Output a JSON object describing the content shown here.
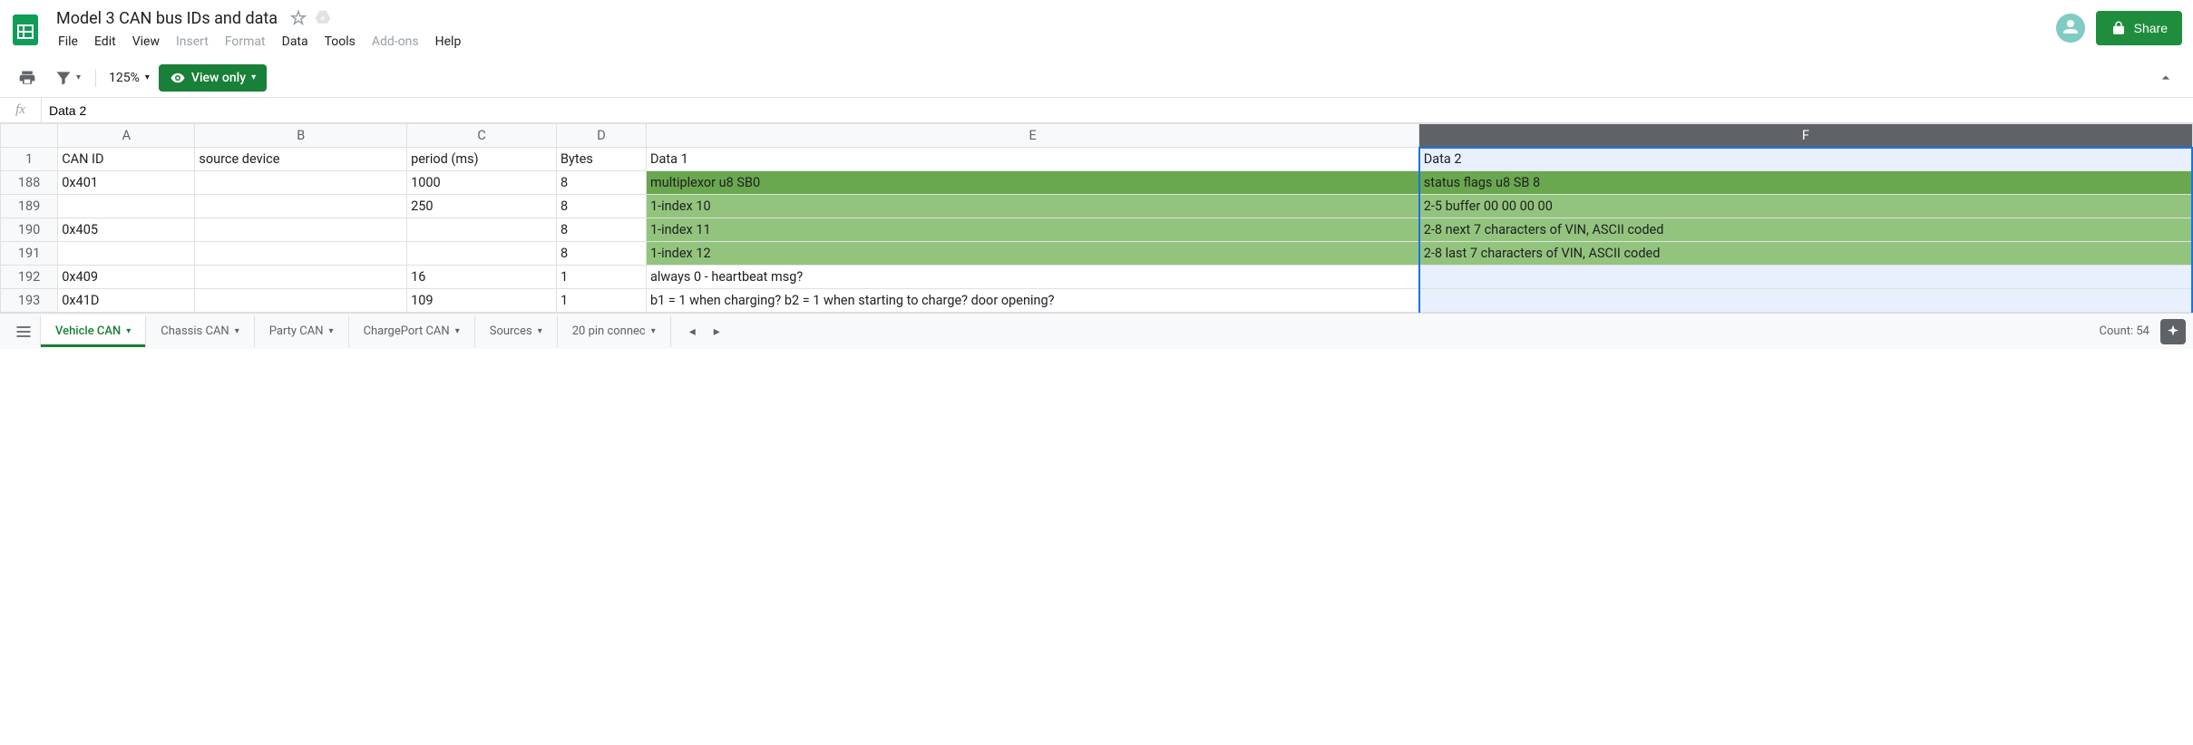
{
  "doc": {
    "title": "Model 3 CAN bus IDs and data"
  },
  "menus": {
    "file": "File",
    "edit": "Edit",
    "view": "View",
    "insert": "Insert",
    "format": "Format",
    "data": "Data",
    "tools": "Tools",
    "addons": "Add-ons",
    "help": "Help"
  },
  "share": {
    "label": "Share"
  },
  "toolbar": {
    "zoom": "125%",
    "view_only": "View only"
  },
  "formula": {
    "value": "Data 2"
  },
  "columns": {
    "labels": [
      "A",
      "B",
      "C",
      "D",
      "E",
      "F"
    ],
    "widths": [
      110,
      170,
      120,
      72,
      620,
      620
    ]
  },
  "headers": {
    "a": "CAN ID",
    "b": "source device",
    "c": "period (ms)",
    "d": "Bytes",
    "e": "Data 1",
    "f": "Data 2"
  },
  "rows": [
    {
      "num": "188",
      "a": "0x401",
      "b": "",
      "c": "1000",
      "d": "8",
      "e": "multiplexor u8 SB0",
      "f": "status flags u8 SB 8",
      "eClass": "cell-green1",
      "fClass": "cell-green1"
    },
    {
      "num": "189",
      "a": "",
      "b": "",
      "c": "250",
      "d": "8",
      "e": "1-index 10",
      "f": "2-5 buffer 00 00 00 00",
      "eClass": "cell-green2",
      "fClass": "cell-green2"
    },
    {
      "num": "190",
      "a": "0x405",
      "b": "",
      "c": "",
      "d": "8",
      "e": "1-index 11",
      "f": "2-8 next 7 characters of VIN, ASCII coded",
      "eClass": "cell-green2",
      "fClass": "cell-green2"
    },
    {
      "num": "191",
      "a": "",
      "b": "",
      "c": "",
      "d": "8",
      "e": "1-index 12",
      "f": "2-8 last 7 characters of VIN, ASCII coded",
      "eClass": "cell-green2",
      "fClass": "cell-green2"
    },
    {
      "num": "192",
      "a": "0x409",
      "b": "",
      "c": "16",
      "d": "1",
      "e": "always 0 - heartbeat msg?",
      "f": "",
      "eClass": "",
      "fClass": "cell-selected-col"
    },
    {
      "num": "193",
      "a": "0x41D",
      "b": "",
      "c": "109",
      "d": "1",
      "e": "b1 = 1 when charging?  b2 = 1 when starting to charge?  door opening?",
      "f": "",
      "eClass": "",
      "fClass": "cell-selected-col"
    }
  ],
  "tabs": {
    "items": [
      {
        "label": "Vehicle CAN",
        "active": true
      },
      {
        "label": "Chassis CAN",
        "active": false
      },
      {
        "label": "Party CAN",
        "active": false
      },
      {
        "label": "ChargePort CAN",
        "active": false
      },
      {
        "label": "Sources",
        "active": false
      },
      {
        "label": "20 pin connec",
        "active": false
      }
    ]
  },
  "status": {
    "count": "Count: 54"
  }
}
